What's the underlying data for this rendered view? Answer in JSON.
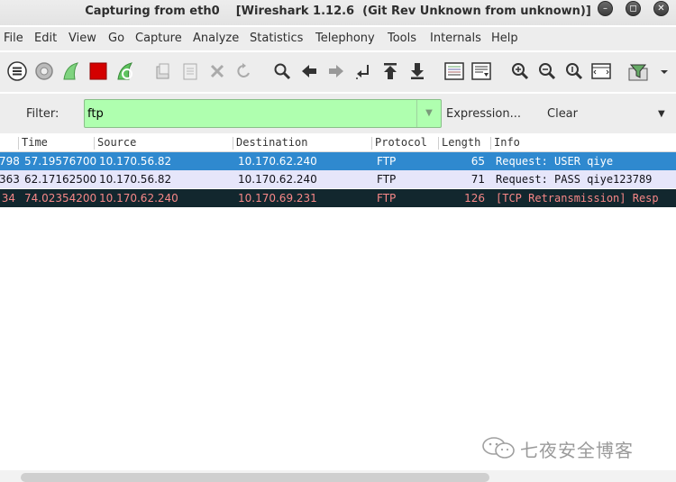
{
  "window": {
    "title": "Capturing from eth0    [Wireshark 1.12.6  (Git Rev Unknown from unknown)]",
    "controls": [
      "minimize",
      "maximize",
      "close"
    ]
  },
  "menu": [
    "File",
    "Edit",
    "View",
    "Go",
    "Capture",
    "Analyze",
    "Statistics",
    "Telephony",
    "Tools",
    "Internals",
    "Help"
  ],
  "filter": {
    "label": "Filter:",
    "value": "ftp",
    "expression_label": "Expression...",
    "clear_label": "Clear",
    "color": "#afffaf"
  },
  "packet_list": {
    "columns": [
      "Time",
      "Source",
      "Destination",
      "Protocol",
      "Length",
      "Info"
    ],
    "rows": [
      {
        "no": "798",
        "time": "57.19576700",
        "source": "10.170.56.82",
        "destination": "10.170.62.240",
        "protocol": "FTP",
        "length": "65",
        "info": "Request: USER qiye",
        "selected": true
      },
      {
        "no": "363",
        "time": "62.17162500",
        "source": "10.170.56.82",
        "destination": "10.170.62.240",
        "protocol": "FTP",
        "length": "71",
        "info": "Request: PASS qiye123789",
        "selected": false
      },
      {
        "no": "34",
        "time": "74.02354200",
        "source": "10.170.62.240",
        "destination": "10.170.69.231",
        "protocol": "FTP",
        "length": "126",
        "info": "[TCP Retransmission] Resp",
        "selected": false
      }
    ]
  },
  "colors": {
    "selected_row": "#2f89cf",
    "ftp_row": "#e6e6fa",
    "bad_tcp_row": "#12272e",
    "bad_tcp_text": "#f78787"
  },
  "watermark": {
    "text": "七夜安全博客"
  }
}
